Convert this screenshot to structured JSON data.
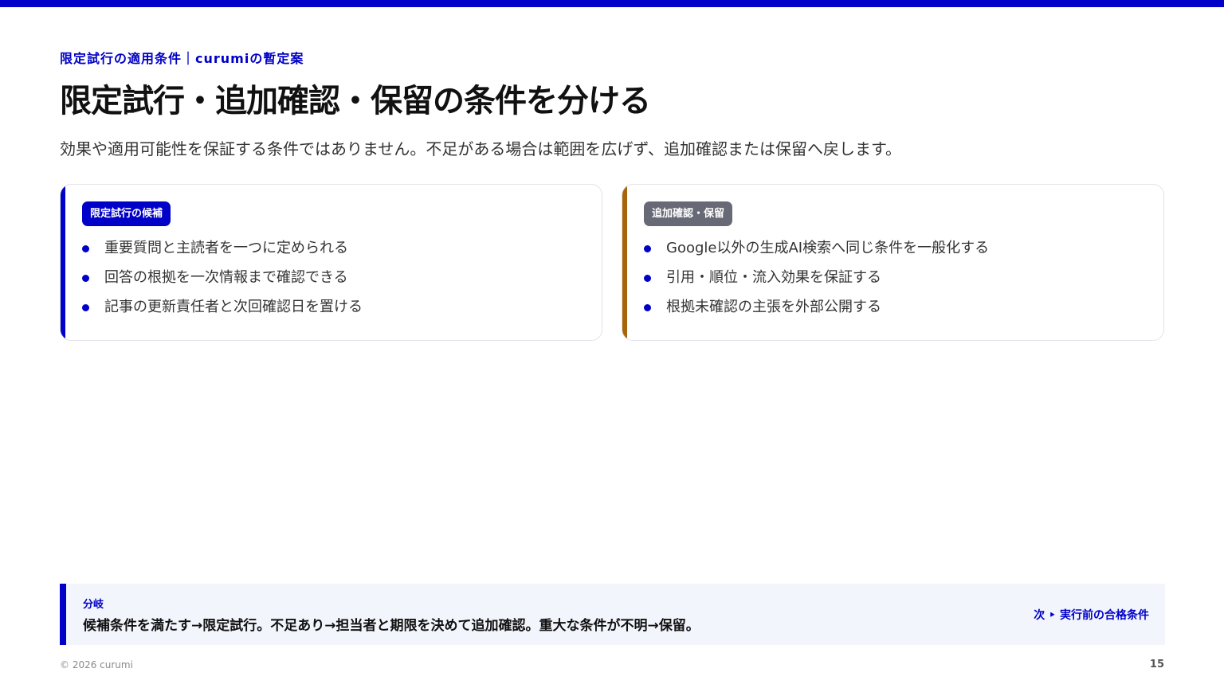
{
  "slide": {
    "kicker": "限定試行の適用条件｜curumiの暫定案",
    "title": "限定試行・追加確認・保留の条件を分ける",
    "subtitle": "効果や適用可能性を保証する条件ではありません。不足がある場合は範囲を広げず、追加確認または保留へ戻します。"
  },
  "cards": [
    {
      "badge": "限定試行の候補",
      "items": [
        "重要質問と主読者を一つに定められる",
        "回答の根拠を一次情報まで確認できる",
        "記事の更新責任者と次回確認日を置ける"
      ]
    },
    {
      "badge": "追加確認・保留",
      "items": [
        "Google以外の生成AI検索へ同じ条件を一般化する",
        "引用・順位・流入効果を保証する",
        "根拠未確認の主張を外部公開する"
      ]
    }
  ],
  "footer": {
    "label": "分岐",
    "text": "候補条件を満たす→限定試行。不足あり→担当者と期限を決めて追加確認。重大な条件が不明→保留。",
    "next": "次 ‣ 実行前の合格条件"
  },
  "copyright": "© 2026 curumi",
  "page_number": "15",
  "colors": {
    "accent": "#0000c8",
    "accent_secondary": "#a86408",
    "badge_gray": "#676a76",
    "footer_bg": "#f2f5fc"
  }
}
